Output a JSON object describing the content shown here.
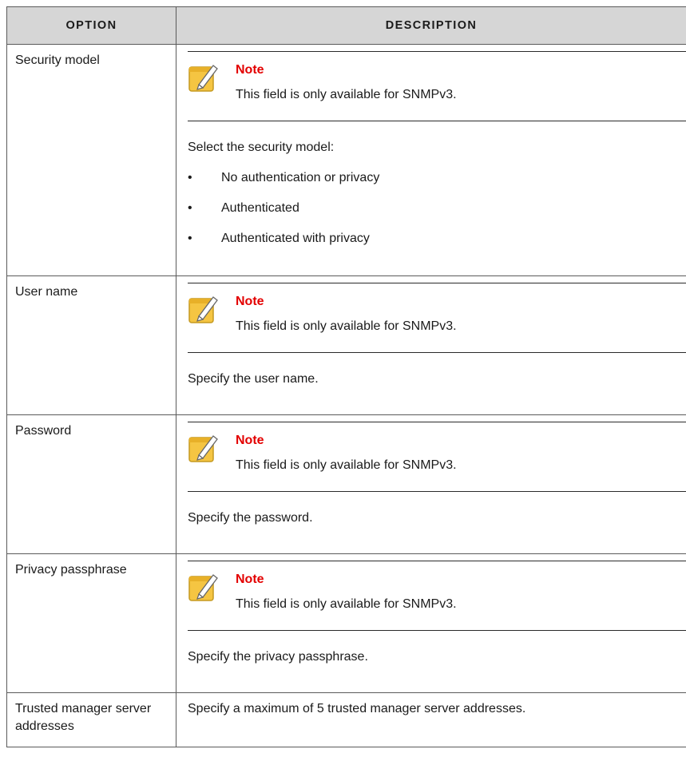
{
  "headers": {
    "option": "Option",
    "description": "Description"
  },
  "note_label": "Note",
  "note_text": "This field is only available for SNMPv3.",
  "rows": [
    {
      "option": "Security model",
      "intro": "Select the security model:",
      "bullets": [
        "No authentication or privacy",
        "Authenticated",
        "Authenticated with privacy"
      ]
    },
    {
      "option": "User name",
      "text": "Specify the user name."
    },
    {
      "option": "Password",
      "text": "Specify the password."
    },
    {
      "option": "Privacy passphrase",
      "text": "Specify the privacy passphrase."
    },
    {
      "option": "Trusted manager server addresses",
      "text": "Specify a maximum of 5 trusted manager server addresses."
    }
  ],
  "icons": {
    "note": "pencil-note-icon"
  },
  "colors": {
    "note_label": "#e30000",
    "header_bg": "#d6d6d6",
    "pencil_pad": "#f5c542"
  }
}
